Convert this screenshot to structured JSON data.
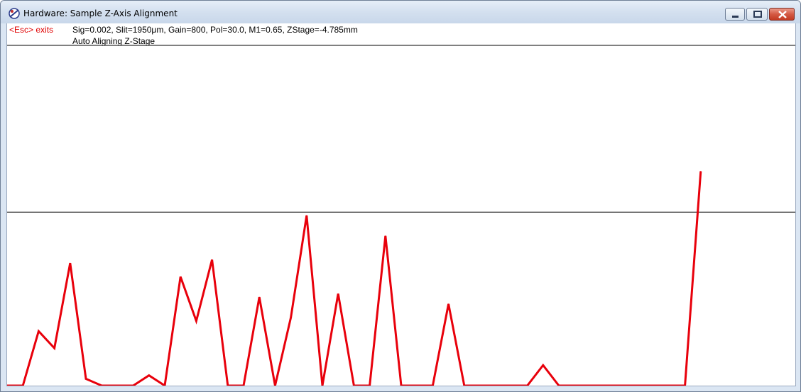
{
  "window": {
    "title": "Hardware: Sample Z-Axis Alignment",
    "icon": "app-icon"
  },
  "controls": {
    "minimize": "minimize-icon",
    "maximize": "maximize-icon",
    "close": "close-icon"
  },
  "header": {
    "esc_label": "<Esc> exits",
    "status": "Sig=0.002, Slit=1950μm, Gain=800, Pol=30.0, M1=0.65, ZStage=-4.785mm",
    "mode": "Auto Aligning Z-Stage"
  },
  "colors": {
    "trace": "#e8000b",
    "guide": "#000000",
    "esc": "#e00000"
  },
  "chart_data": {
    "type": "line",
    "title": "",
    "xlabel": "",
    "ylabel": "",
    "ylim": [
      0,
      100
    ],
    "grid": false,
    "reference_line": 51,
    "series": [
      {
        "values": [
          0,
          0,
          16,
          11,
          36,
          2,
          0,
          0,
          0,
          3,
          0,
          32,
          19,
          37,
          0,
          0,
          26,
          0,
          20,
          50,
          0,
          27,
          0,
          0,
          44,
          0,
          0,
          0,
          24,
          0,
          0,
          0,
          0,
          0,
          6,
          0,
          0,
          0,
          0,
          0,
          0,
          0,
          0,
          0,
          63
        ]
      }
    ]
  }
}
